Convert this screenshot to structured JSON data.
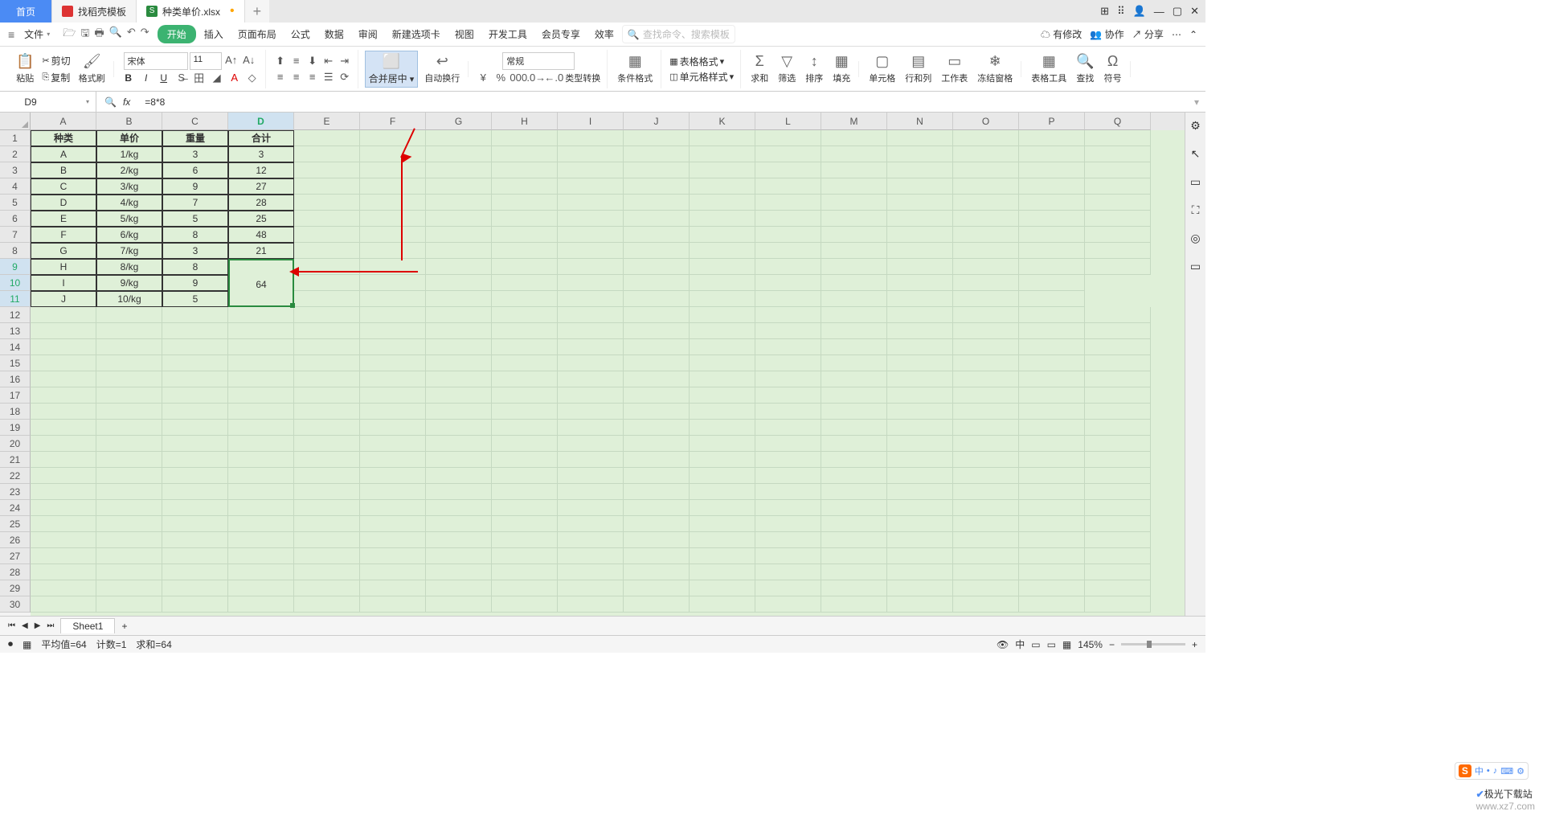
{
  "titlebar": {
    "home_tab": "首页",
    "templates_tab": "找稻壳模板",
    "file_tab": "种类单价.xlsx",
    "plus": "+"
  },
  "wincontrols": {
    "min": "—",
    "max": "▢",
    "close": "✕"
  },
  "menubar": {
    "file": "文件",
    "items": [
      "开始",
      "插入",
      "页面布局",
      "公式",
      "数据",
      "审阅",
      "新建选项卡",
      "视图",
      "开发工具",
      "会员专享",
      "效率"
    ],
    "search_placeholder": "查找命令、搜索模板",
    "right": {
      "changes": "有修改",
      "collab": "协作",
      "share": "分享"
    }
  },
  "ribbon": {
    "paste": "粘贴",
    "cut": "剪切",
    "copy": "复制",
    "format_painter": "格式刷",
    "font_name": "宋体",
    "font_size": "11",
    "merge": "合并居中",
    "wrap": "自动换行",
    "number_format": "常规",
    "type_convert": "类型转换",
    "cond_fmt": "条件格式",
    "table_style": "表格格式",
    "cell_style": "单元格样式",
    "sum": "求和",
    "filter": "筛选",
    "sort": "排序",
    "fill": "填充",
    "cells": "单元格",
    "rowcol": "行和列",
    "sheet": "工作表",
    "freeze": "冻结窗格",
    "table_tools": "表格工具",
    "find": "查找",
    "symbol": "符号"
  },
  "formulabar": {
    "cell_ref": "D9",
    "formula": "=8*8"
  },
  "columns": [
    "A",
    "B",
    "C",
    "D",
    "E",
    "F",
    "G",
    "H",
    "I",
    "J",
    "K",
    "L",
    "M",
    "N",
    "O",
    "P",
    "Q"
  ],
  "rows": [
    "1",
    "2",
    "3",
    "4",
    "5",
    "6",
    "7",
    "8",
    "9",
    "10",
    "11",
    "12",
    "13",
    "14",
    "15",
    "16",
    "17",
    "18",
    "19",
    "20",
    "21",
    "22",
    "23",
    "24",
    "25",
    "26",
    "27",
    "28",
    "29",
    "30"
  ],
  "selected_col": "D",
  "selected_rows": [
    "9",
    "10",
    "11"
  ],
  "table": {
    "headers": [
      "种类",
      "单价",
      "重量",
      "合计"
    ],
    "rows": [
      [
        "A",
        "1/kg",
        "3",
        "3"
      ],
      [
        "B",
        "2/kg",
        "6",
        "12"
      ],
      [
        "C",
        "3/kg",
        "9",
        "27"
      ],
      [
        "D",
        "4/kg",
        "7",
        "28"
      ],
      [
        "E",
        "5/kg",
        "5",
        "25"
      ],
      [
        "F",
        "6/kg",
        "8",
        "48"
      ],
      [
        "G",
        "7/kg",
        "3",
        "21"
      ],
      [
        "H",
        "8/kg",
        "8",
        ""
      ],
      [
        "I",
        "9/kg",
        "9",
        ""
      ],
      [
        "J",
        "10/kg",
        "5",
        ""
      ]
    ],
    "merged_value": "64"
  },
  "sheettabs": {
    "name": "Sheet1",
    "plus": "+"
  },
  "statusbar": {
    "avg": "平均值=64",
    "count": "计数=1",
    "sum": "求和=64",
    "zoom": "145%",
    "zoom_minus": "−",
    "zoom_plus": "+"
  },
  "ime": {
    "logo": "S",
    "chars": [
      "中",
      "•",
      "♪",
      "⌨",
      "⚙"
    ]
  },
  "logo": {
    "name": "极光下载站",
    "url": "www.xz7.com"
  }
}
